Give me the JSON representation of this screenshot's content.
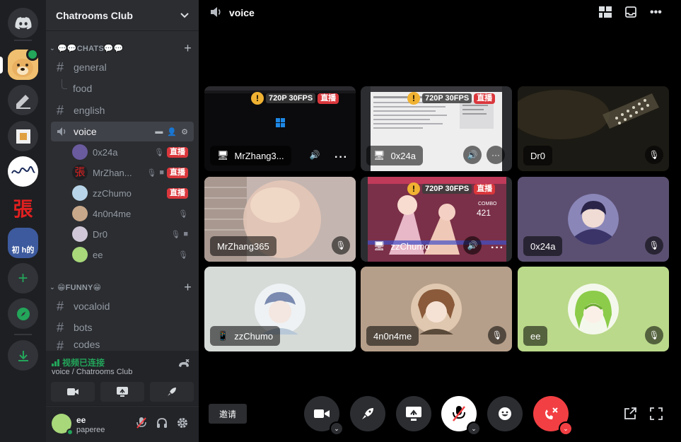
{
  "server": {
    "name": "Chatrooms Club",
    "rail": [
      {
        "label": "",
        "icon": "discord-home-icon",
        "color": "#313338"
      },
      {
        "label": "",
        "icon": "doge-server-avatar",
        "color": "#e8a33d"
      },
      {
        "label": "",
        "icon": "pencil-server-avatar",
        "color": "#313338"
      },
      {
        "label": "",
        "icon": "square-server-avatar",
        "color": "#313338"
      },
      {
        "label": "",
        "icon": "signature-server-avatar",
        "color": "#ffffff"
      },
      {
        "label": "張",
        "icon": "zhang-server-avatar",
        "color": "#1e1f22"
      },
      {
        "label": "初 h的",
        "icon": "anime-server-avatar",
        "color": "#3d5a9e"
      }
    ]
  },
  "sidebar": {
    "categories": [
      {
        "label": "💬💬CHATS💬💬",
        "plus": "+"
      },
      {
        "label": "😁FUNNY😁",
        "plus": "+"
      }
    ],
    "channels": [
      {
        "label": "general",
        "type": "text"
      },
      {
        "label": "food",
        "type": "thread"
      },
      {
        "label": "english",
        "type": "text"
      },
      {
        "label": "voice",
        "type": "voice"
      },
      {
        "label": "vocaloid",
        "type": "text"
      },
      {
        "label": "bots",
        "type": "text"
      },
      {
        "label": "codes",
        "type": "text"
      }
    ],
    "voice_users": [
      {
        "name": "0x24a",
        "live": "直播",
        "avatar": "#6a5a9e"
      },
      {
        "name": "MrZhan...",
        "live": "直播",
        "avatar": "#c0392b"
      },
      {
        "name": "zzChumo",
        "live": "直播",
        "avatar": "#b8d4e8"
      },
      {
        "name": "4n0n4me",
        "live": "",
        "avatar": "#c8a88a"
      },
      {
        "name": "Dr0",
        "live": "",
        "avatar": "#d0c8d8"
      },
      {
        "name": "ee",
        "live": "",
        "avatar": "#a8d87a"
      }
    ]
  },
  "voice_panel": {
    "status": "视频已连接",
    "location": "voice / Chatrooms Club"
  },
  "user": {
    "name": "ee",
    "tag": "paperee"
  },
  "stage": {
    "channel": "voice",
    "tiles": [
      {
        "name": "MrZhang3...",
        "quality": "720P 30FPS",
        "live": "直播",
        "bg": "#0b0b0d",
        "kind": "stream"
      },
      {
        "name": "0x24a",
        "quality": "720P 30FPS",
        "live": "直播",
        "bg": "#e9e9ea",
        "kind": "stream"
      },
      {
        "name": "Dr0",
        "quality": "",
        "live": "",
        "bg": "#1c1a14",
        "kind": "camera"
      },
      {
        "name": "MrZhang365",
        "quality": "",
        "live": "",
        "bg": "#b9a8a4",
        "kind": "camera"
      },
      {
        "name": "zzChumo",
        "quality": "720P 30FPS",
        "live": "直播",
        "bg": "#7a3048",
        "kind": "stream"
      },
      {
        "name": "0x24a",
        "quality": "",
        "live": "",
        "bg": "#5b5072",
        "kind": "avatar"
      },
      {
        "name": "zzChumo",
        "quality": "",
        "live": "",
        "bg": "#d6dbd8",
        "kind": "avatar"
      },
      {
        "name": "4n0n4me",
        "quality": "",
        "live": "",
        "bg": "#b69f8a",
        "kind": "avatar"
      },
      {
        "name": "ee",
        "quality": "",
        "live": "",
        "bg": "#bad98a",
        "kind": "avatar"
      }
    ],
    "quality_number": "421",
    "combo_label": "COMBO"
  },
  "controls": {
    "invite": "邀请"
  },
  "colors": {
    "accent_green": "#23a55a",
    "live_red": "#da373c",
    "hangup_red": "#f23f43"
  }
}
